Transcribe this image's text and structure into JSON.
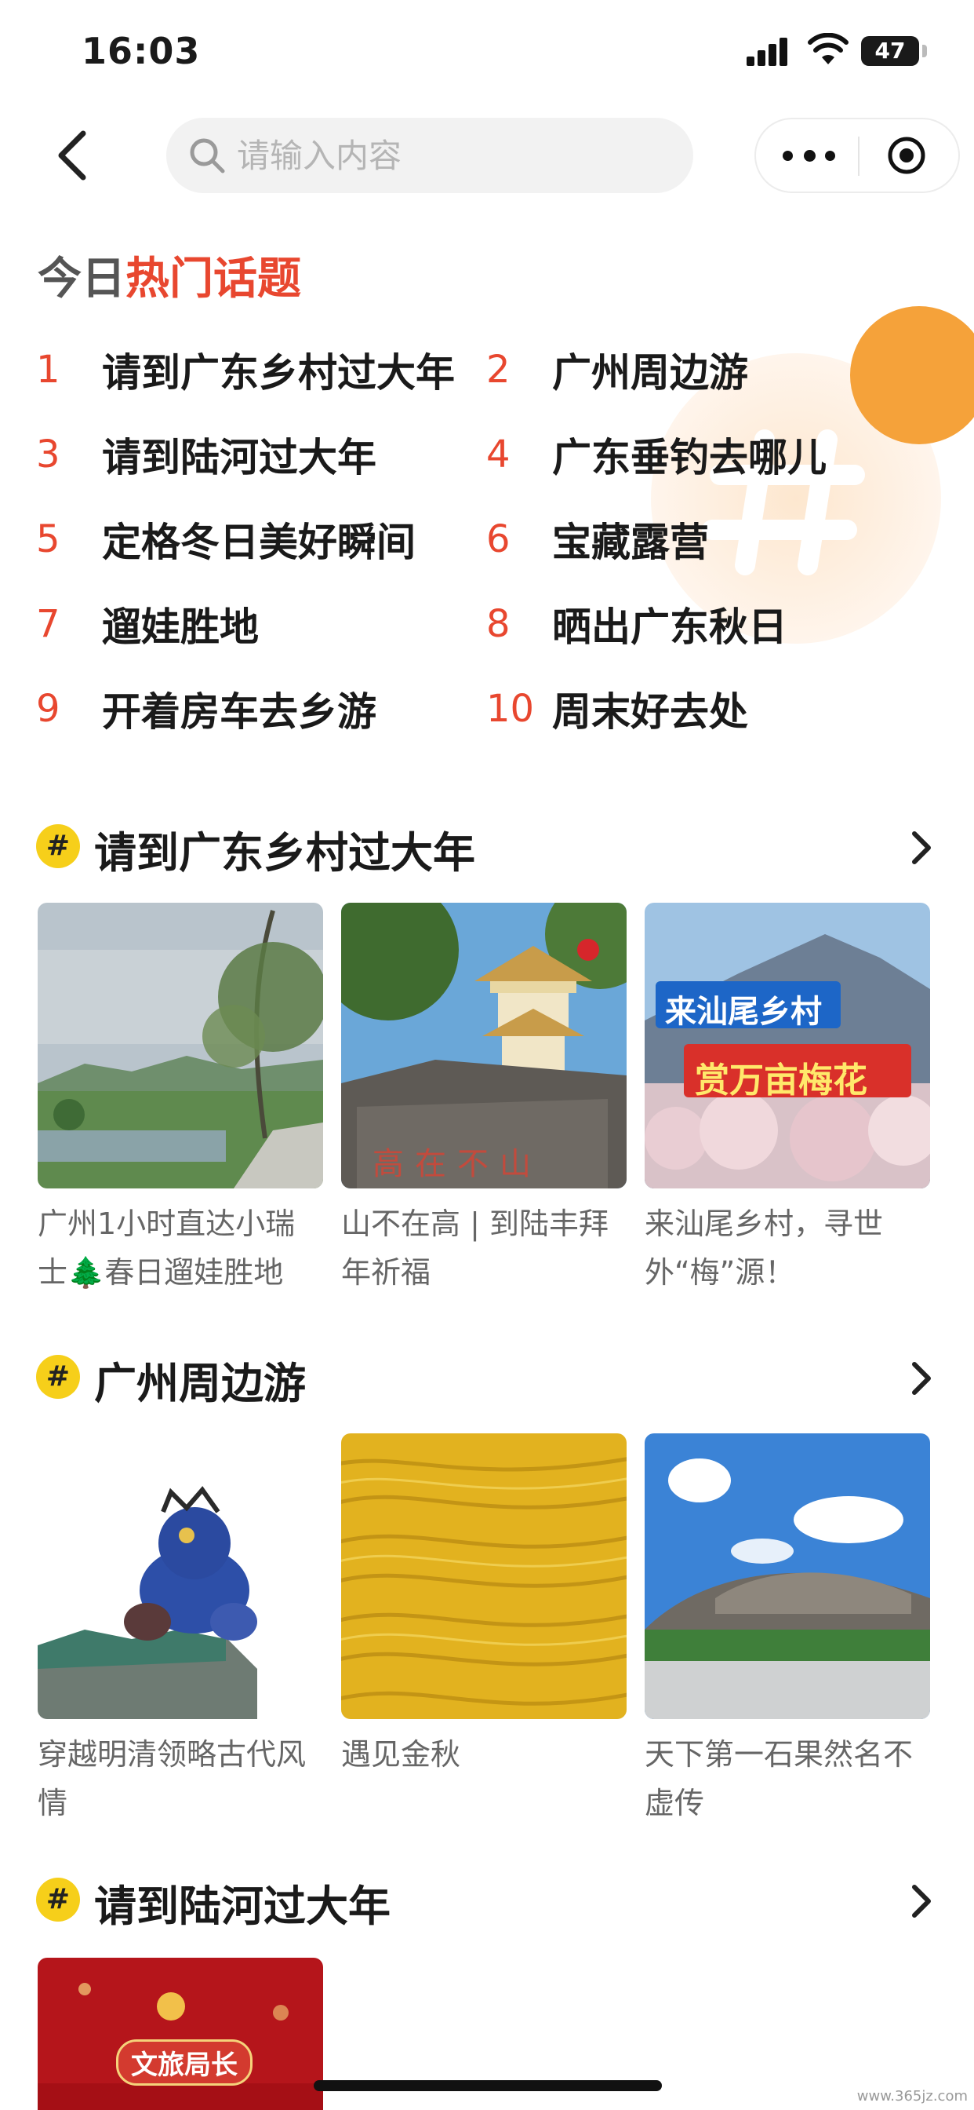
{
  "status_bar": {
    "time": "16:03",
    "battery": "47"
  },
  "search": {
    "placeholder": "请输入内容"
  },
  "hot_topics": {
    "title_prefix": "今日",
    "title_accent": "热门话题",
    "items": [
      {
        "num": "1",
        "label": "请到广东乡村过大年"
      },
      {
        "num": "2",
        "label": "广州周边游"
      },
      {
        "num": "3",
        "label": "请到陆河过大年"
      },
      {
        "num": "4",
        "label": "广东垂钓去哪儿"
      },
      {
        "num": "5",
        "label": "定格冬日美好瞬间"
      },
      {
        "num": "6",
        "label": "宝藏露营"
      },
      {
        "num": "7",
        "label": "遛娃胜地"
      },
      {
        "num": "8",
        "label": "晒出广东秋日"
      },
      {
        "num": "9",
        "label": "开着房车去乡游"
      },
      {
        "num": "10",
        "label": "周末好去处"
      }
    ]
  },
  "sections": [
    {
      "badge": "#",
      "title": "请到广东乡村过大年",
      "cards": [
        {
          "caption": "广州1小时直达小瑞士🌲春日遛娃胜地"
        },
        {
          "caption": "山不在高 | 到陆丰拜年祈福",
          "rock_text": "高在不山"
        },
        {
          "caption": "来汕尾乡村，寻世外“梅”源！",
          "banner_line1": "来汕尾乡村",
          "banner_line2": "赏万亩梅花"
        }
      ]
    },
    {
      "badge": "#",
      "title": "广州周边游",
      "cards": [
        {
          "caption": "穿越明清领略古代风情"
        },
        {
          "caption": "遇见金秋"
        },
        {
          "caption": "天下第一石果然名不虚传"
        }
      ]
    },
    {
      "badge": "#",
      "title": "请到陆河过大年",
      "cards": [
        {
          "caption": "",
          "poster_tag": "文旅局长"
        }
      ]
    }
  ],
  "watermark": "www.365jz.com",
  "colors": {
    "accent": "#e8472f",
    "badge": "#f6cf1a",
    "deco_orange": "#f5a23a"
  }
}
